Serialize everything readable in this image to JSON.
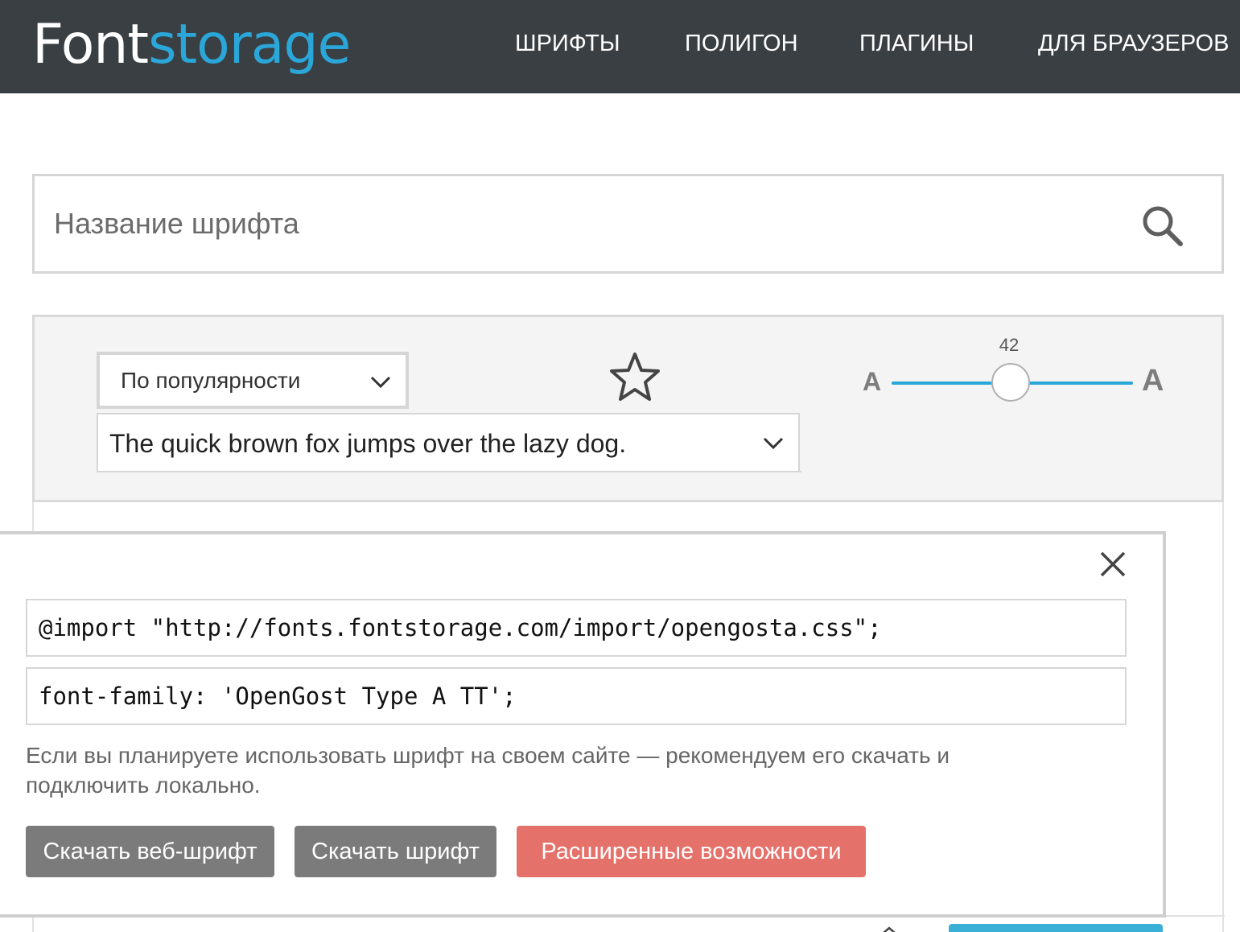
{
  "header": {
    "logo_part1": "Font",
    "logo_part2": "storage",
    "nav": [
      "ШРИФТЫ",
      "ПОЛИГОН",
      "ПЛАГИНЫ",
      "ДЛЯ БРАУЗЕРОВ"
    ]
  },
  "search": {
    "placeholder": "Название шрифта",
    "value": "",
    "icon": "search-icon"
  },
  "filters": {
    "sort_selected": "По популярности",
    "sample_selected": "The quick brown fox jumps over the lazy dog.",
    "favorites_icon": "star-icon",
    "size_slider": {
      "value": "42",
      "min_label": "A",
      "max_label": "A",
      "level": 0.5
    }
  },
  "popup": {
    "close_icon": "close-icon",
    "import_code": "@import \"http://fonts.fontstorage.com/import/opengosta.css\";",
    "font_family_code": "font-family: 'OpenGost Type A TT';",
    "hint": "Если вы планируете использовать шрифт на своем сайте — рекомендуем его скачать и подключить локально.",
    "buttons": {
      "download_web": "Скачать веб-шрифт",
      "download_font": "Скачать шрифт",
      "advanced": "Расширенные возможности"
    }
  },
  "colors": {
    "header_bg": "#3a3f44",
    "accent": "#2aa7d8",
    "button_gray": "#7b7b7b",
    "button_red": "#e5716b"
  }
}
